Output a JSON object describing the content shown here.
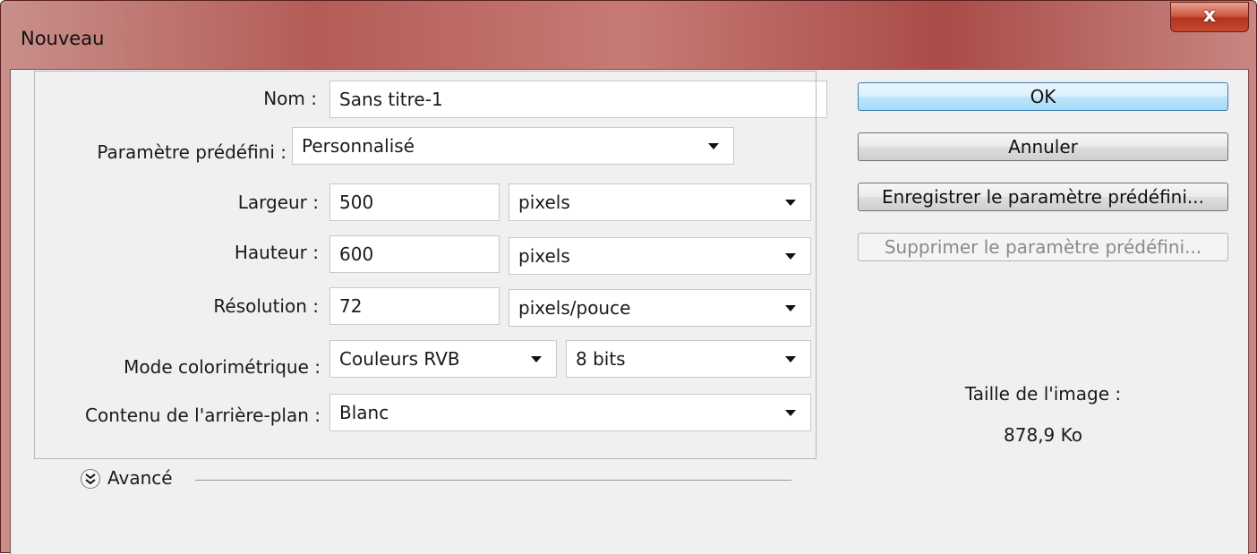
{
  "window": {
    "title": "Nouveau",
    "close_glyph": "x"
  },
  "name_row": {
    "label": "Nom :",
    "value": "Sans titre-1"
  },
  "preset": {
    "label": "Paramètre prédéfini :",
    "value": "Personnalisé"
  },
  "width": {
    "label": "Largeur :",
    "value": "500",
    "unit": "pixels"
  },
  "height": {
    "label": "Hauteur :",
    "value": "600",
    "unit": "pixels"
  },
  "resolution": {
    "label": "Résolution :",
    "value": "72",
    "unit": "pixels/pouce"
  },
  "color_mode": {
    "label": "Mode colorimétrique :",
    "mode": "Couleurs RVB",
    "depth": "8 bits"
  },
  "background": {
    "label": "Contenu de l'arrière-plan :",
    "value": "Blanc"
  },
  "advanced": {
    "label": "Avancé",
    "icon": "chevron-double-down-icon"
  },
  "buttons": {
    "ok": "OK",
    "cancel": "Annuler",
    "save_preset": "Enregistrer le paramètre prédéfini...",
    "delete_preset": "Supprimer le paramètre prédéfini..."
  },
  "image_size": {
    "label": "Taille de l'image :",
    "value": "878,9 Ko"
  },
  "colors": {
    "title_bar": "#b45c58",
    "close_button": "#c44a30",
    "dialog_bg": "#f0f0f0",
    "ok_highlight": "#bee6fd"
  }
}
